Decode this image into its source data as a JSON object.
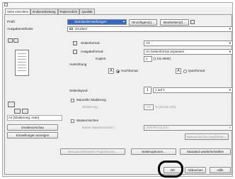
{
  "tabs": [
    "Seite einrichten",
    "Endverarbeitung",
    "Papierzufuhr",
    "Qualität"
  ],
  "profile": {
    "label": "Profil:",
    "value": "Standardeinstellungen",
    "add_button": "Hinzufügen(1)...",
    "edit_button": "Bearbeiten(2)..."
  },
  "output_method": {
    "label": "Ausgabemethode:",
    "value": "Drucken"
  },
  "page_format": {
    "label": "Seitenformat:",
    "value": "A4"
  },
  "output_format": {
    "label": "Ausgabeformat:",
    "value": "An Seitenformat anpassen"
  },
  "copies": {
    "label": "Kopien:",
    "value": "1",
    "range": "[1 bis 9999]"
  },
  "orientation": {
    "label": "Ausrichtung",
    "portrait_letter": "A",
    "portrait": "Hochformat",
    "landscape_letter": "A",
    "landscape": "Querformat",
    "selected": "portrait"
  },
  "layout": {
    "label": "Seitenlayout:",
    "icon_number": "1",
    "value": "1 auf 1"
  },
  "manual_scaling": {
    "label": "Manuelle Skalierung",
    "sub_label": "Skalierung:",
    "value": "100",
    "range": "% [25 bis 200]"
  },
  "watermark": {
    "label": "Wasserzeichen",
    "name_label": "Name Wasserzeichen:",
    "value": "VERTRAULICH",
    "edit_button": "Wasserzeichen bearbeiten..."
  },
  "preview_status": "A4 [Skalierung: Auto]",
  "left_buttons": {
    "device_preview": "Gerätevorschau",
    "show_settings": "Einstellungen anzeigen"
  },
  "bottom": {
    "user_paper_button": "Benutzerdefiniertes Papierformat...",
    "page_options_button": "Seitenoptionen...",
    "restore_defaults_button": "Standard wiederherstellen"
  },
  "dialog_buttons": {
    "ok": "OK",
    "cancel": "Abbrechen",
    "help": "Hilfe"
  },
  "colors": {
    "selection": "#316ac5",
    "ok_highlight": "#000000"
  }
}
